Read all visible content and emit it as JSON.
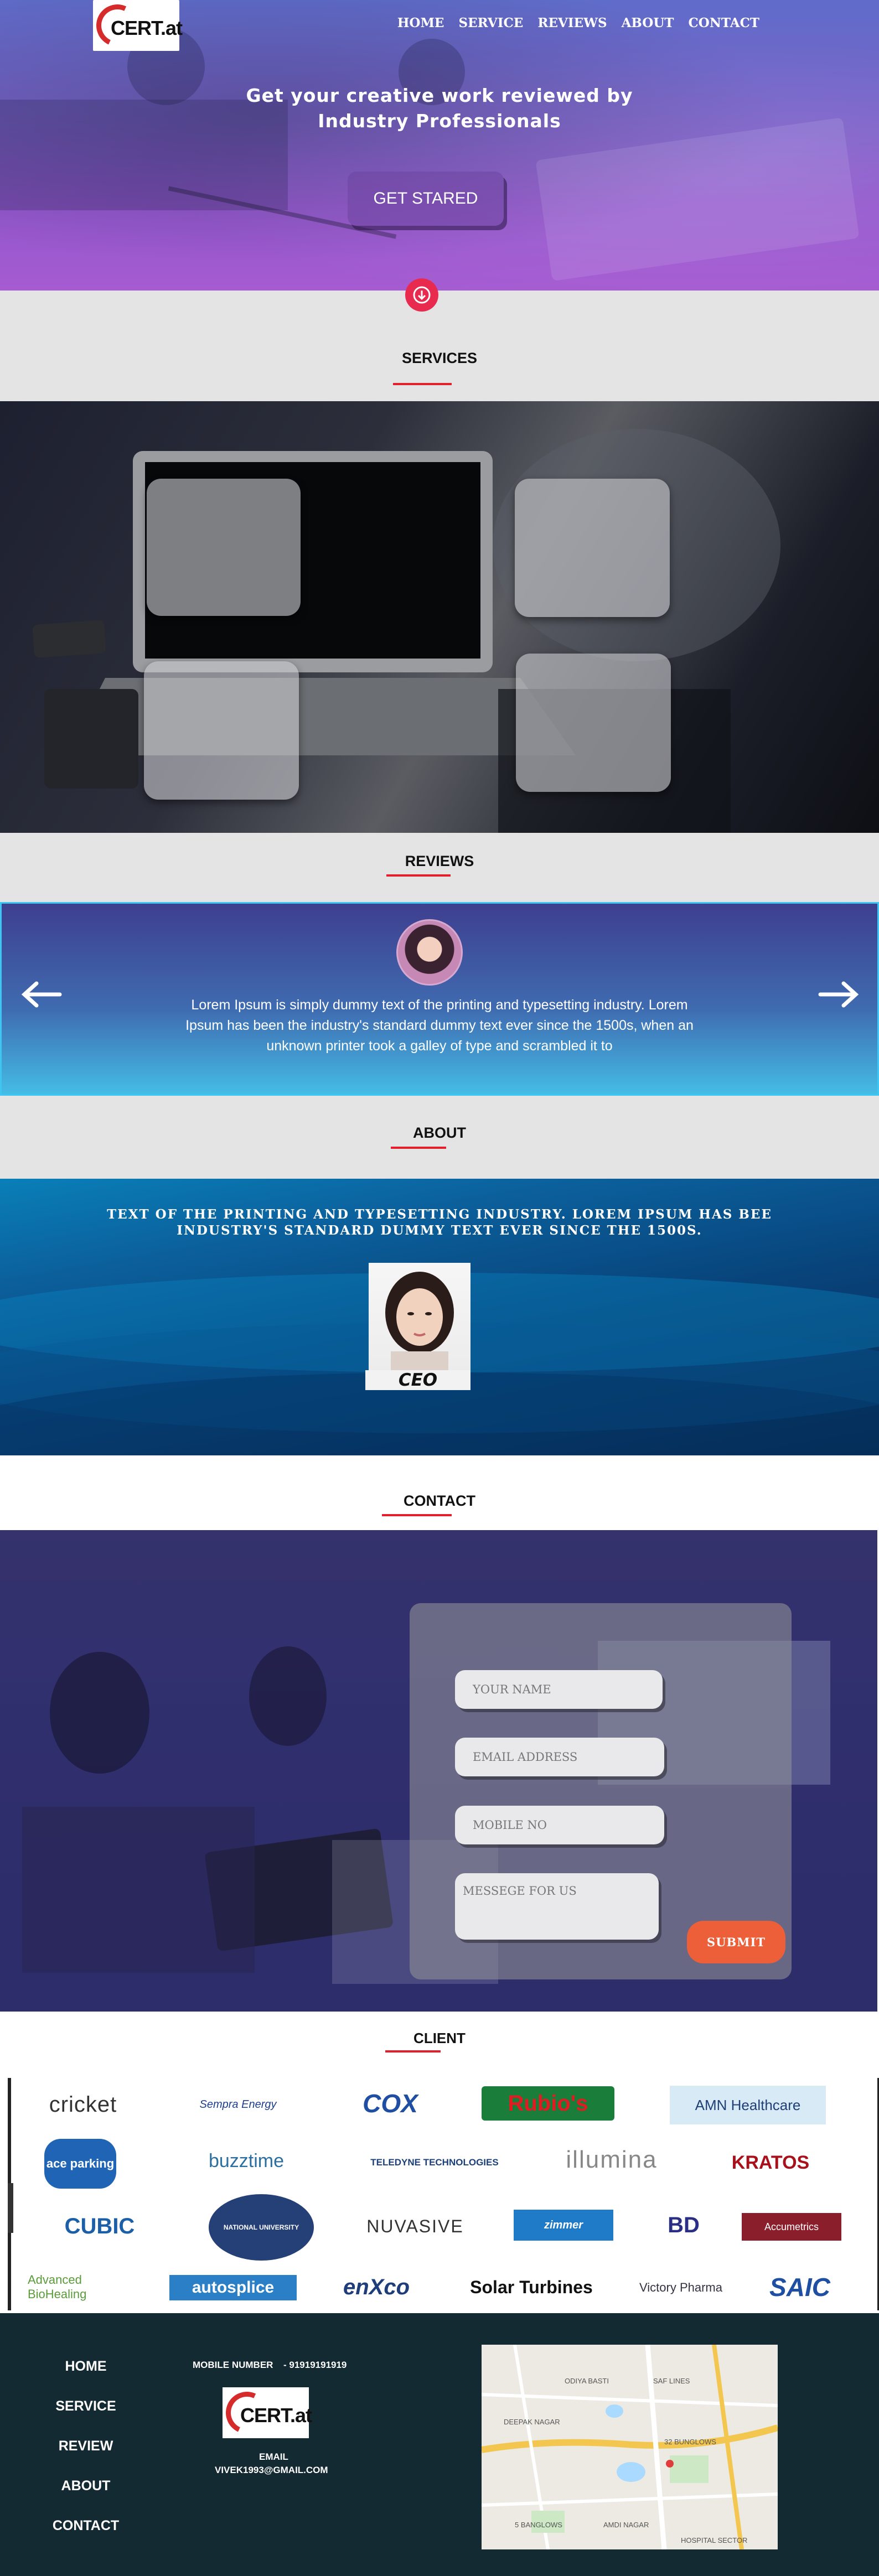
{
  "brand": {
    "logo_text": "CERT.at"
  },
  "nav": {
    "items": [
      "HOME",
      "SERVICE",
      "REVIEWS",
      "ABOUT",
      "CONTACT"
    ]
  },
  "hero": {
    "title_line1": "Get your creative work reviewed by",
    "title_line2": "Industry Professionals",
    "cta_label": "GET STARED",
    "down_icon": "arrow-down-icon"
  },
  "services": {
    "title": "SERVICES"
  },
  "reviews": {
    "title": "REVIEWS",
    "text": "Lorem Ipsum is simply dummy text of the printing and typesetting industry. Lorem Ipsum has been the industry's standard dummy text ever since the 1500s, when an unknown printer took a galley of type and scrambled it to",
    "prev_icon": "arrow-left-icon",
    "next_icon": "arrow-right-icon"
  },
  "about": {
    "title": "ABOUT",
    "text_line1": "TEXT OF THE PRINTING AND TYPESETTING INDUSTRY. LOREM IPSUM HAS BEE",
    "text_line2": "INDUSTRY'S STANDARD DUMMY TEXT EVER SINCE THE 1500S.",
    "ceo_label": "CEO"
  },
  "contact": {
    "title": "CONTACT",
    "name_placeholder": "YOUR NAME",
    "email_placeholder": "EMAIL ADDRESS",
    "mobile_placeholder": "MOBILE NO",
    "message_placeholder": "MESSEGE FOR US",
    "submit_label": "SUBMIT"
  },
  "client": {
    "title": "CLIENT",
    "logos": [
      "cricket",
      "Sempra Energy",
      "COX",
      "Rubio's",
      "AMN Healthcare",
      "ace parking",
      "buzztime",
      "TELEDYNE TECHNOLOGIES",
      "illumina",
      "KRATOS",
      "CUBIC",
      "NATIONAL UNIVERSITY",
      "NUVASIVE",
      "zimmer",
      "BD",
      "Accumetrics",
      "Advanced BioHealing",
      "autosplice",
      "enXco",
      "Solar Turbines",
      "Victory Pharma",
      "SAIC"
    ]
  },
  "footer": {
    "nav": [
      "HOME",
      "SERVICE",
      "REVIEW",
      "ABOUT",
      "CONTACT"
    ],
    "mobile_label": "MOBILE NUMBER",
    "mobile_value": "- 91919191919",
    "email_label": "EMAIL",
    "email_value": "VIVEK1993@GMAIL.COM",
    "map_labels": [
      "ODIYA BASTI",
      "SAF LINES",
      "DEEPAK NAGAR",
      "32 BUNGLOWS",
      "5 BANGLOWS",
      "AMDI NAGAR",
      "HOSPITAL SECTOR"
    ]
  },
  "colors": {
    "accent_red": "#e31e2d",
    "submit_orange": "#ec5f38",
    "footer_bg": "#142a33",
    "hero_purple": "#9257cc"
  }
}
